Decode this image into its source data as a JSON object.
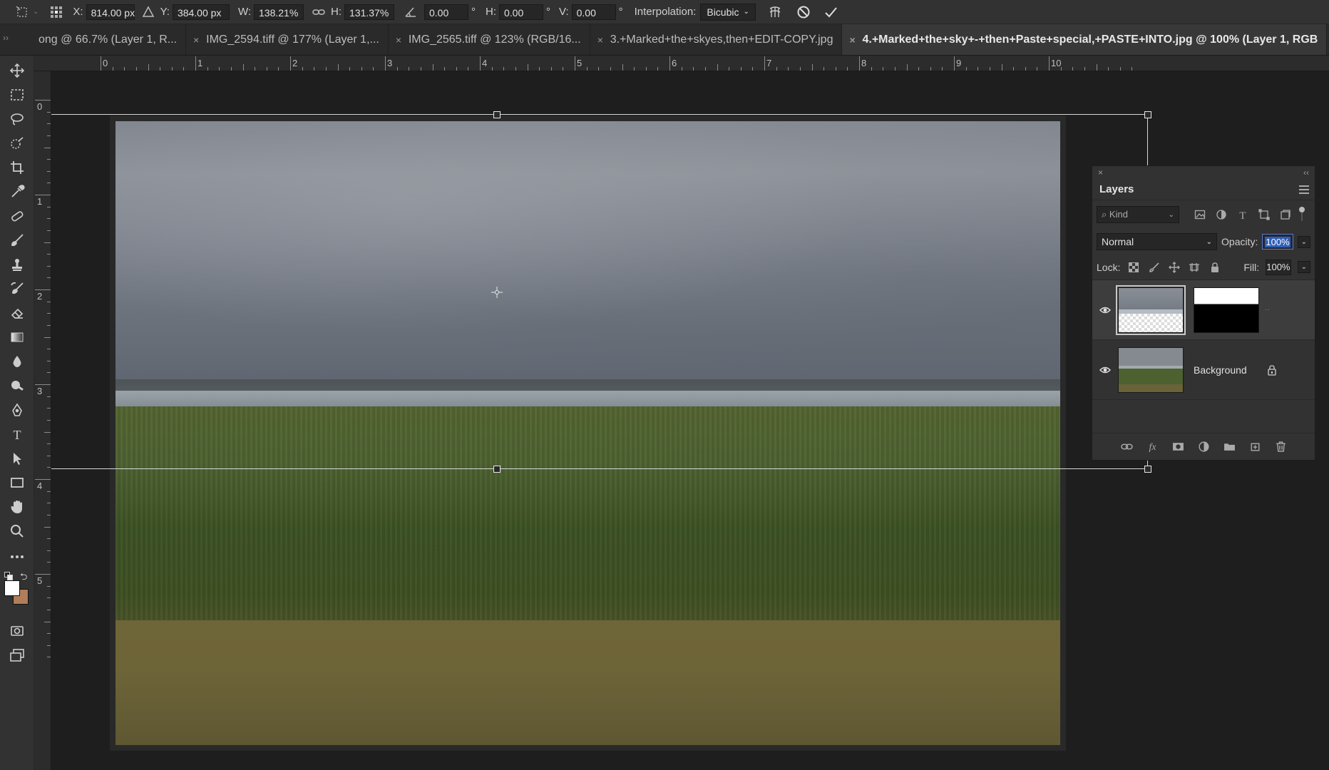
{
  "options_bar": {
    "x_label": "X:",
    "x_value": "814.00 px",
    "y_label": "Y:",
    "y_value": "384.00 px",
    "w_label": "W:",
    "w_value": "138.21%",
    "h_label": "H:",
    "h_value": "131.37%",
    "angle_value": "0.00",
    "degree_symbol": "°",
    "hskew_label": "H:",
    "hskew_value": "0.00",
    "vskew_label": "V:",
    "vskew_value": "0.00",
    "interpolation_label": "Interpolation:",
    "interpolation_value": "Bicubic"
  },
  "tabs": [
    {
      "label": "ong @ 66.7% (Layer 1, R..."
    },
    {
      "label": "IMG_2594.tiff @ 177% (Layer 1,..."
    },
    {
      "label": "IMG_2565.tiff @ 123% (RGB/16..."
    },
    {
      "label": "3.+Marked+the+skyes,then+EDIT-COPY.jpg"
    },
    {
      "label": "4.+Marked+the+sky+-+then+Paste+special,+PASTE+INTO.jpg @ 100% (Layer 1, RGB"
    }
  ],
  "tab_close_glyph": "×",
  "ruler_top": [
    "0",
    "1",
    "2",
    "3",
    "4",
    "5",
    "6",
    "7",
    "8",
    "9",
    "10"
  ],
  "ruler_left": [
    "0",
    "1",
    "2",
    "3",
    "4",
    "5"
  ],
  "layers_panel": {
    "close_glyph": "×",
    "collapse_glyph": "‹‹",
    "title": "Layers",
    "filter_kind": "Kind",
    "blend_mode": "Normal",
    "opacity_label": "Opacity:",
    "opacity_value": "100%",
    "lock_label": "Lock:",
    "fill_label": "Fill:",
    "fill_value": "100%",
    "layers": [
      {
        "name": "",
        "visible": true,
        "has_mask": true,
        "selected": true
      },
      {
        "name": "Background",
        "visible": true,
        "locked": true
      }
    ]
  },
  "colors": {
    "foreground": "#ffffff",
    "background": "#b07e5a",
    "selection_accent": "#2f5fb8"
  },
  "icons": {
    "tools": [
      "move-icon",
      "marquee-icon",
      "lasso-icon",
      "quick-select-icon",
      "crop-icon",
      "eyedropper-icon",
      "healing-brush-icon",
      "brush-icon",
      "clone-stamp-icon",
      "history-brush-icon",
      "eraser-icon",
      "gradient-icon",
      "blur-icon",
      "dodge-icon",
      "pen-icon",
      "type-icon",
      "path-select-icon",
      "rectangle-icon",
      "hand-icon",
      "zoom-icon",
      "more-tools-icon"
    ]
  }
}
